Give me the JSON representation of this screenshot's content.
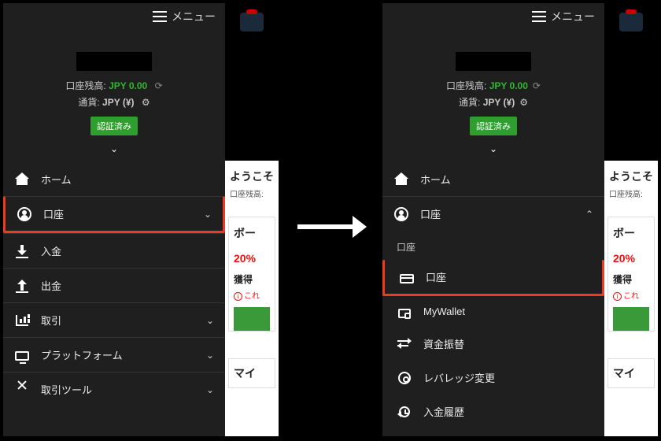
{
  "topbar": {
    "menu_label": "メニュー"
  },
  "header": {
    "balance_label": "口座残高:",
    "balance_value": "JPY 0.00",
    "currency_label": "通貨:",
    "currency_value": "JPY (¥)",
    "verified_badge": "認証済み"
  },
  "menu": {
    "home": "ホーム",
    "account": "口座",
    "deposit": "入金",
    "withdraw": "出金",
    "trade": "取引",
    "platform": "プラットフォーム",
    "tools": "取引ツール"
  },
  "submenu": {
    "header": "口座",
    "account": "口座",
    "mywallet": "MyWallet",
    "transfer": "資金振替",
    "leverage": "レバレッジ変更",
    "history": "入金履歴"
  },
  "content": {
    "welcome": "ようこそ",
    "balance_sub": "口座残高:",
    "card_title": "ボー",
    "pct": "20%",
    "grab": "獲得",
    "note": "これ",
    "footer": "マイ"
  }
}
